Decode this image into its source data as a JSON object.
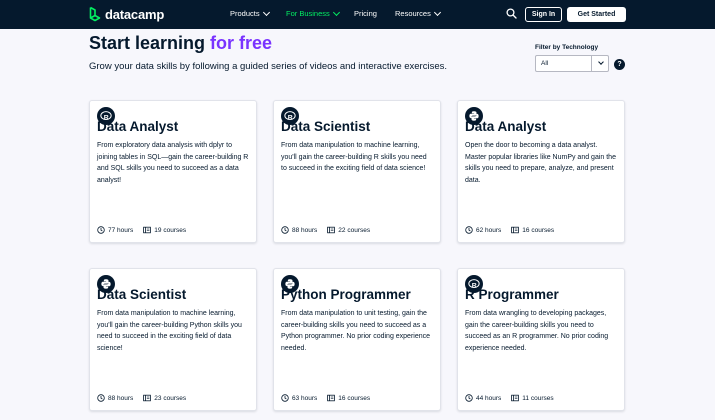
{
  "nav": {
    "logo_text": "datacamp",
    "items": [
      {
        "label": "Products",
        "has_dropdown": true
      },
      {
        "label": "For Business",
        "has_dropdown": true,
        "accent": true
      },
      {
        "label": "Pricing",
        "has_dropdown": false
      },
      {
        "label": "Resources",
        "has_dropdown": true
      }
    ],
    "sign_in": "Sign In",
    "get_started": "Get Started"
  },
  "header": {
    "title_main": "Start learning",
    "title_accent": "for free",
    "subtitle": "Grow your data skills by following a guided series of videos and interactive exercises."
  },
  "filter": {
    "label": "Filter by Technology",
    "value": "All",
    "help": "?"
  },
  "colors": {
    "nav_bg": "#05192d",
    "accent_green": "#03ef62",
    "accent_purple": "#7933ff",
    "text_dark": "#05192d"
  },
  "cards": [
    {
      "tech": "R",
      "tech_icon": "r-logo-icon",
      "title": "Data Analyst",
      "description": "From exploratory data analysis with dplyr to joining tables in SQL—gain the career-building R and SQL skills you need to succeed as a data analyst!",
      "hours": "77 hours",
      "courses": "19 courses"
    },
    {
      "tech": "R",
      "tech_icon": "r-logo-icon",
      "title": "Data Scientist",
      "description": "From data manipulation to machine learning, you'll gain the career-building R skills you need to succeed in the exciting field of data science!",
      "hours": "88 hours",
      "courses": "22 courses"
    },
    {
      "tech": "Python",
      "tech_icon": "python-logo-icon",
      "title": "Data Analyst",
      "description": "Open the door to becoming a data analyst. Master popular libraries like NumPy and gain the skills you need to prepare, analyze, and present data.",
      "hours": "62 hours",
      "courses": "16 courses"
    },
    {
      "tech": "Python",
      "tech_icon": "python-logo-icon",
      "title": "Data Scientist",
      "description": "From data manipulation to machine learning, you'll gain the career-building Python skills you need to succeed in the exciting field of data science!",
      "hours": "88 hours",
      "courses": "23 courses"
    },
    {
      "tech": "Python",
      "tech_icon": "python-logo-icon",
      "title": "Python Programmer",
      "description": "From data manipulation to unit testing, gain the career-building skills you need to succeed as a Python programmer. No prior coding experience needed.",
      "hours": "63 hours",
      "courses": "16 courses"
    },
    {
      "tech": "R",
      "tech_icon": "r-logo-icon",
      "title": "R Programmer",
      "description": "From data wrangling to developing packages, gain the career-building skills you need to succeed as an R programmer. No prior coding experience needed.",
      "hours": "44 hours",
      "courses": "11 courses"
    }
  ]
}
